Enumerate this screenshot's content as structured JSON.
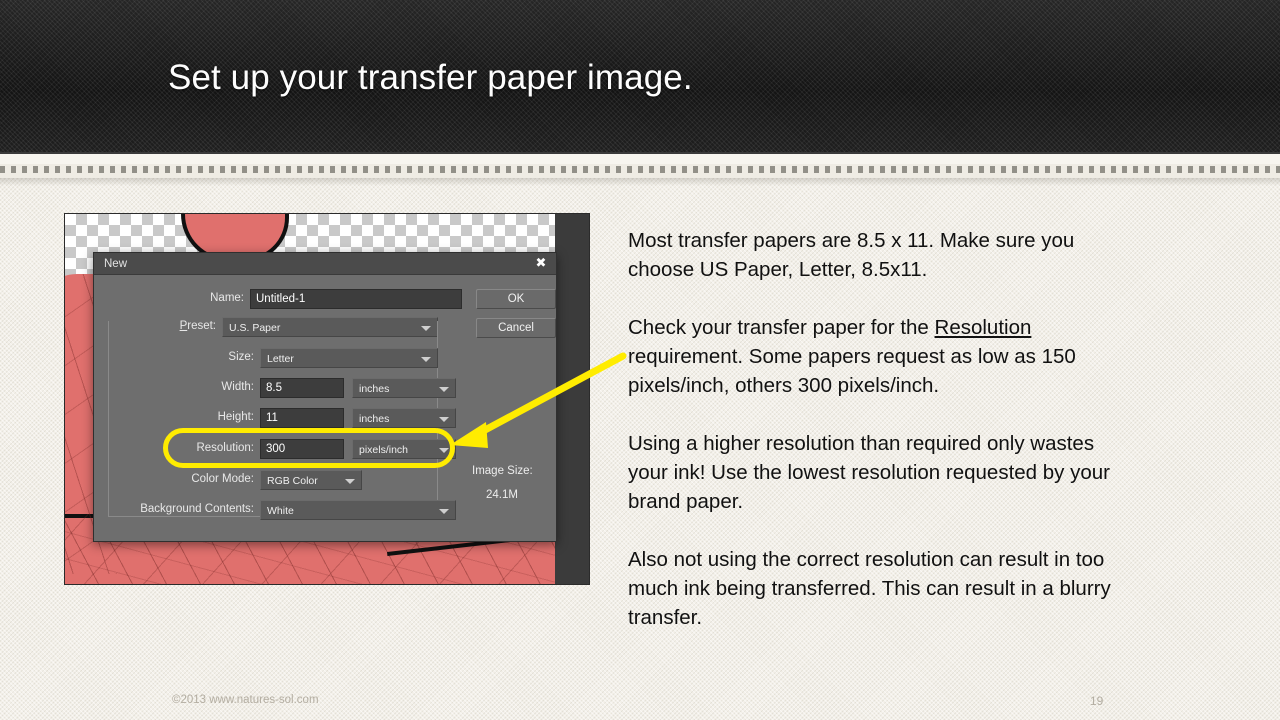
{
  "slide": {
    "title": "Set up your transfer paper image.",
    "footer_copyright": "©2013 www.natures-sol.com",
    "page_number": "19",
    "accent_color": "#ffec00",
    "banner_color": "#1d1d1d",
    "paper_color": "#f3f0e9"
  },
  "screenshot": {
    "dialog": {
      "title": "New",
      "close_icon": "close-icon",
      "fields": {
        "name_label": "Name:",
        "name_value": "Untitled-1",
        "preset_label": "Preset:",
        "preset_label_accel": "P",
        "preset_label_rest": "reset:",
        "preset_value": "U.S. Paper",
        "size_label": "Size:",
        "size_value": "Letter",
        "width_label": "Width:",
        "width_value": "8.5",
        "width_units": "inches",
        "height_label": "Height:",
        "height_value": "11",
        "height_units": "inches",
        "resolution_label": "Resolution:",
        "resolution_value": "300",
        "resolution_units": "pixels/inch",
        "color_mode_label": "Color Mode:",
        "color_mode_value": "RGB Color",
        "background_contents_label": "Background Contents:",
        "background_contents_value": "White"
      },
      "buttons": {
        "ok": "OK",
        "cancel": "Cancel"
      },
      "image_size": {
        "label": "Image Size:",
        "value": "24.1M"
      }
    }
  },
  "body": {
    "paragraph_1": "Most transfer papers are 8.5 x 11. Make sure you choose US Paper, Letter, 8.5x11.",
    "paragraph_2_before": "Check your transfer paper for the ",
    "paragraph_2_underlined": "Resolution",
    "paragraph_2_after": " requirement. Some papers request as low as 150 pixels/inch, others 300 pixels/inch.",
    "paragraph_3": "Using a higher resolution than required only wastes your ink! Use the lowest resolution requested by your brand paper.",
    "paragraph_4": "Also not using the correct resolution can result in too much ink being transferred. This can result in a blurry transfer."
  }
}
